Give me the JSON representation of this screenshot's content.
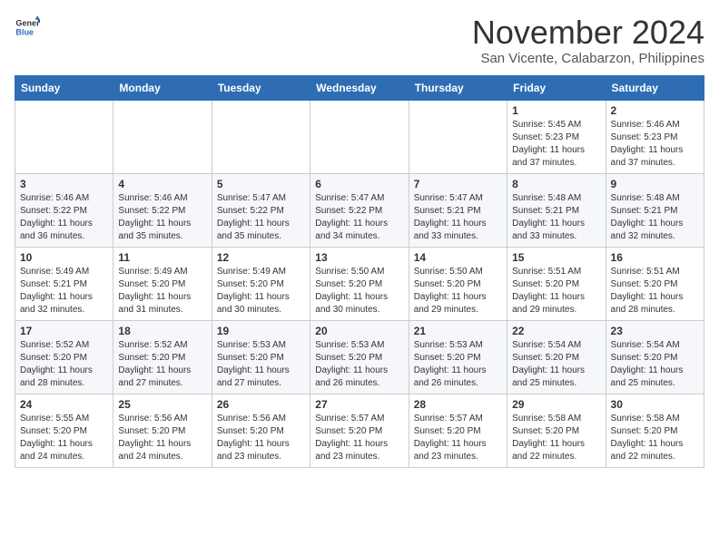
{
  "logo": {
    "line1": "General",
    "line2": "Blue"
  },
  "title": "November 2024",
  "location": "San Vicente, Calabarzon, Philippines",
  "weekdays": [
    "Sunday",
    "Monday",
    "Tuesday",
    "Wednesday",
    "Thursday",
    "Friday",
    "Saturday"
  ],
  "weeks": [
    [
      {
        "day": "",
        "sunrise": "",
        "sunset": "",
        "daylight": ""
      },
      {
        "day": "",
        "sunrise": "",
        "sunset": "",
        "daylight": ""
      },
      {
        "day": "",
        "sunrise": "",
        "sunset": "",
        "daylight": ""
      },
      {
        "day": "",
        "sunrise": "",
        "sunset": "",
        "daylight": ""
      },
      {
        "day": "",
        "sunrise": "",
        "sunset": "",
        "daylight": ""
      },
      {
        "day": "1",
        "sunrise": "Sunrise: 5:45 AM",
        "sunset": "Sunset: 5:23 PM",
        "daylight": "Daylight: 11 hours and 37 minutes."
      },
      {
        "day": "2",
        "sunrise": "Sunrise: 5:46 AM",
        "sunset": "Sunset: 5:23 PM",
        "daylight": "Daylight: 11 hours and 37 minutes."
      }
    ],
    [
      {
        "day": "3",
        "sunrise": "Sunrise: 5:46 AM",
        "sunset": "Sunset: 5:22 PM",
        "daylight": "Daylight: 11 hours and 36 minutes."
      },
      {
        "day": "4",
        "sunrise": "Sunrise: 5:46 AM",
        "sunset": "Sunset: 5:22 PM",
        "daylight": "Daylight: 11 hours and 35 minutes."
      },
      {
        "day": "5",
        "sunrise": "Sunrise: 5:47 AM",
        "sunset": "Sunset: 5:22 PM",
        "daylight": "Daylight: 11 hours and 35 minutes."
      },
      {
        "day": "6",
        "sunrise": "Sunrise: 5:47 AM",
        "sunset": "Sunset: 5:22 PM",
        "daylight": "Daylight: 11 hours and 34 minutes."
      },
      {
        "day": "7",
        "sunrise": "Sunrise: 5:47 AM",
        "sunset": "Sunset: 5:21 PM",
        "daylight": "Daylight: 11 hours and 33 minutes."
      },
      {
        "day": "8",
        "sunrise": "Sunrise: 5:48 AM",
        "sunset": "Sunset: 5:21 PM",
        "daylight": "Daylight: 11 hours and 33 minutes."
      },
      {
        "day": "9",
        "sunrise": "Sunrise: 5:48 AM",
        "sunset": "Sunset: 5:21 PM",
        "daylight": "Daylight: 11 hours and 32 minutes."
      }
    ],
    [
      {
        "day": "10",
        "sunrise": "Sunrise: 5:49 AM",
        "sunset": "Sunset: 5:21 PM",
        "daylight": "Daylight: 11 hours and 32 minutes."
      },
      {
        "day": "11",
        "sunrise": "Sunrise: 5:49 AM",
        "sunset": "Sunset: 5:20 PM",
        "daylight": "Daylight: 11 hours and 31 minutes."
      },
      {
        "day": "12",
        "sunrise": "Sunrise: 5:49 AM",
        "sunset": "Sunset: 5:20 PM",
        "daylight": "Daylight: 11 hours and 30 minutes."
      },
      {
        "day": "13",
        "sunrise": "Sunrise: 5:50 AM",
        "sunset": "Sunset: 5:20 PM",
        "daylight": "Daylight: 11 hours and 30 minutes."
      },
      {
        "day": "14",
        "sunrise": "Sunrise: 5:50 AM",
        "sunset": "Sunset: 5:20 PM",
        "daylight": "Daylight: 11 hours and 29 minutes."
      },
      {
        "day": "15",
        "sunrise": "Sunrise: 5:51 AM",
        "sunset": "Sunset: 5:20 PM",
        "daylight": "Daylight: 11 hours and 29 minutes."
      },
      {
        "day": "16",
        "sunrise": "Sunrise: 5:51 AM",
        "sunset": "Sunset: 5:20 PM",
        "daylight": "Daylight: 11 hours and 28 minutes."
      }
    ],
    [
      {
        "day": "17",
        "sunrise": "Sunrise: 5:52 AM",
        "sunset": "Sunset: 5:20 PM",
        "daylight": "Daylight: 11 hours and 28 minutes."
      },
      {
        "day": "18",
        "sunrise": "Sunrise: 5:52 AM",
        "sunset": "Sunset: 5:20 PM",
        "daylight": "Daylight: 11 hours and 27 minutes."
      },
      {
        "day": "19",
        "sunrise": "Sunrise: 5:53 AM",
        "sunset": "Sunset: 5:20 PM",
        "daylight": "Daylight: 11 hours and 27 minutes."
      },
      {
        "day": "20",
        "sunrise": "Sunrise: 5:53 AM",
        "sunset": "Sunset: 5:20 PM",
        "daylight": "Daylight: 11 hours and 26 minutes."
      },
      {
        "day": "21",
        "sunrise": "Sunrise: 5:53 AM",
        "sunset": "Sunset: 5:20 PM",
        "daylight": "Daylight: 11 hours and 26 minutes."
      },
      {
        "day": "22",
        "sunrise": "Sunrise: 5:54 AM",
        "sunset": "Sunset: 5:20 PM",
        "daylight": "Daylight: 11 hours and 25 minutes."
      },
      {
        "day": "23",
        "sunrise": "Sunrise: 5:54 AM",
        "sunset": "Sunset: 5:20 PM",
        "daylight": "Daylight: 11 hours and 25 minutes."
      }
    ],
    [
      {
        "day": "24",
        "sunrise": "Sunrise: 5:55 AM",
        "sunset": "Sunset: 5:20 PM",
        "daylight": "Daylight: 11 hours and 24 minutes."
      },
      {
        "day": "25",
        "sunrise": "Sunrise: 5:56 AM",
        "sunset": "Sunset: 5:20 PM",
        "daylight": "Daylight: 11 hours and 24 minutes."
      },
      {
        "day": "26",
        "sunrise": "Sunrise: 5:56 AM",
        "sunset": "Sunset: 5:20 PM",
        "daylight": "Daylight: 11 hours and 23 minutes."
      },
      {
        "day": "27",
        "sunrise": "Sunrise: 5:57 AM",
        "sunset": "Sunset: 5:20 PM",
        "daylight": "Daylight: 11 hours and 23 minutes."
      },
      {
        "day": "28",
        "sunrise": "Sunrise: 5:57 AM",
        "sunset": "Sunset: 5:20 PM",
        "daylight": "Daylight: 11 hours and 23 minutes."
      },
      {
        "day": "29",
        "sunrise": "Sunrise: 5:58 AM",
        "sunset": "Sunset: 5:20 PM",
        "daylight": "Daylight: 11 hours and 22 minutes."
      },
      {
        "day": "30",
        "sunrise": "Sunrise: 5:58 AM",
        "sunset": "Sunset: 5:20 PM",
        "daylight": "Daylight: 11 hours and 22 minutes."
      }
    ]
  ]
}
